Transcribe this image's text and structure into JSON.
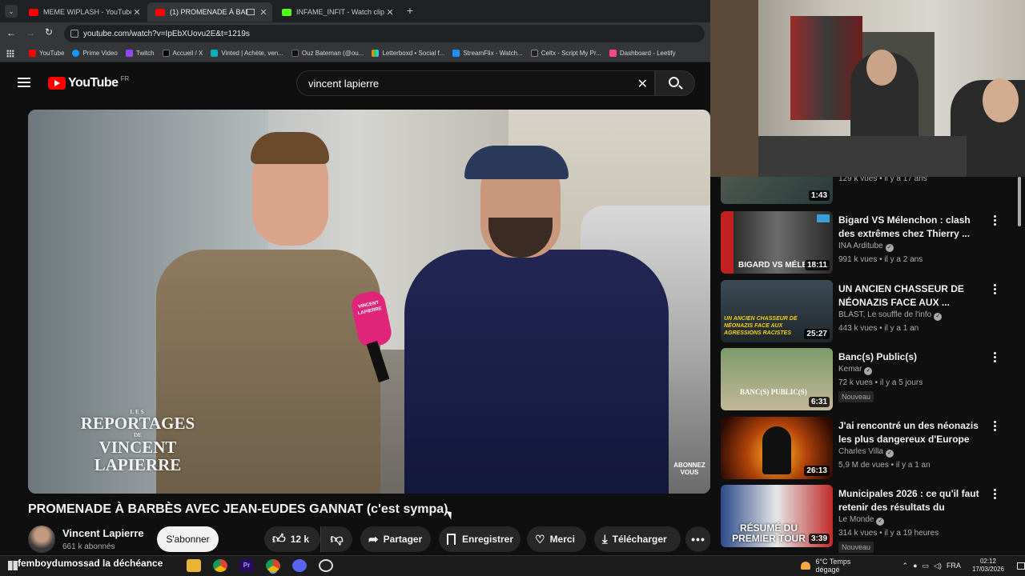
{
  "browser": {
    "tabs": [
      {
        "title": "MEME WIPLASH - YouTube",
        "active": false,
        "color": "#ff0000"
      },
      {
        "title": "(1) PROMENADE À BARBÈS",
        "active": true,
        "color": "#ff0000"
      },
      {
        "title": "INFAME_INFIT - Watch clips on",
        "active": false,
        "color": "#53fc18"
      }
    ],
    "new_tab_label": "+",
    "url": "youtube.com/watch?v=IpEbXUovu2E&t=1219s",
    "bookmarks": [
      {
        "label": "YouTube",
        "color": "#ff0000"
      },
      {
        "label": "Prime Video",
        "color": "#1399ff"
      },
      {
        "label": "Twitch",
        "color": "#9146ff"
      },
      {
        "label": "Accueil / X",
        "color": "#000000"
      },
      {
        "label": "Vinted | Achète, ven...",
        "color": "#09b1ba"
      },
      {
        "label": "Ouz Bateman (@ou...",
        "color": "#111111"
      },
      {
        "label": "Letterboxd • Social f...",
        "color": "#40bcf4"
      },
      {
        "label": "StreamFlix - Watch...",
        "color": "#1f8fff"
      },
      {
        "label": "Celtx - Script My Pr...",
        "color": "#222222"
      },
      {
        "label": "Dashboard - Leetify",
        "color": "#f84982"
      }
    ]
  },
  "youtube": {
    "logo_text": "YouTube",
    "region": "FR",
    "search_value": "vincent lapierre",
    "video": {
      "overlay_line1": "LES",
      "overlay_line2": "REPORTAGES",
      "overlay_line3": "DE",
      "overlay_line4": "VINCENT LAPIERRE",
      "mic_text": "VINCENT LAPIERRE",
      "corner_watermark": "ABONNEZ VOUS"
    },
    "title": "PROMENADE À BARBÈS AVEC JEAN-EUDES GANNAT (c'est sympa)",
    "channel_name": "Vincent Lapierre",
    "subscribers": "661 k abonnés",
    "subscribe_label": "S'abonner",
    "likes": "12 k",
    "share_label": "Partager",
    "save_label": "Enregistrer",
    "thanks_label": "Merci",
    "download_label": "Télécharger"
  },
  "recommendations": [
    {
      "title": "",
      "channel": "",
      "meta": "129 k vues • il y a 17 ans",
      "duration": "1:43",
      "verified": false,
      "badge": ""
    },
    {
      "title": "Bigard VS Mélenchon : clash des extrêmes chez Thierry ...",
      "channel": "INA Arditube",
      "meta": "991 k vues • il y a 2 ans",
      "duration": "18:11",
      "verified": true,
      "badge": "",
      "thumb_text": "BIGARD VS MÉLE"
    },
    {
      "title": "UN ANCIEN CHASSEUR DE NÉONAZIS FACE AUX ...",
      "channel": "BLAST, Le souffle de l'info",
      "meta": "443 k vues • il y a 1 an",
      "duration": "25:27",
      "verified": true,
      "badge": "",
      "thumb_text": "UN ANCIEN CHASSEUR DE NÉONAZIS FACE AUX AGRESSIONS RACISTES"
    },
    {
      "title": "Banc(s) Public(s)",
      "channel": "Kemar",
      "meta": "72 k vues • il y a 5 jours",
      "duration": "6:31",
      "verified": true,
      "badge": "Nouveau",
      "thumb_text": "BANC(S) PUBLIC(S)"
    },
    {
      "title": "J'ai rencontré un des néonazis les plus dangereux d'Europe",
      "channel": "Charles Villa",
      "meta": "5,9 M de vues • il y a 1 an",
      "duration": "26:13",
      "verified": true,
      "badge": ""
    },
    {
      "title": "Municipales 2026 : ce qu'il faut retenir des résultats du premie...",
      "channel": "Le Monde",
      "meta": "314 k vues • il y a 19 heures",
      "duration": "3:39",
      "verified": true,
      "badge": "Nouveau",
      "thumb_text": "RÉSUMÉ DU PREMIER TOUR"
    }
  ],
  "taskbar": {
    "overlay_text": "femboydumossad la déchéance",
    "weather": "6°C  Temps dégagé",
    "language": "FRA",
    "time": "02:12",
    "date": "17/03/2026"
  }
}
